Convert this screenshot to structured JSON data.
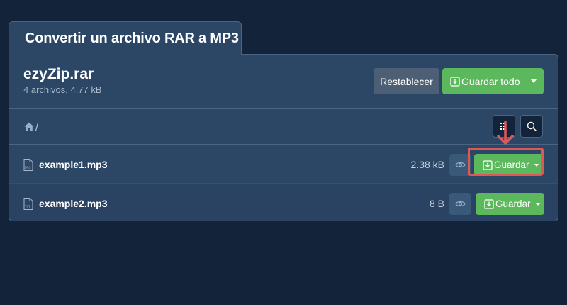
{
  "tab": {
    "title": "Convertir un archivo RAR a MP3"
  },
  "archive": {
    "name": "ezyZip.rar",
    "info": "4 archivos, 4.77 kB"
  },
  "toolbar": {
    "reset_label": "Restablecer",
    "save_all_label": "Guardar todo"
  },
  "path": {
    "current": "/"
  },
  "files": [
    {
      "name": "example1.mp3",
      "size": "2.38 kB",
      "icon_tag": "PNG",
      "save_label": "Guardar"
    },
    {
      "name": "example2.mp3",
      "size": "8 B",
      "icon_tag": "TXT",
      "save_label": "Guardar"
    }
  ],
  "icons": {
    "home": "home-icon",
    "list": "list-icon",
    "search": "search-icon",
    "file": "file-icon",
    "eye": "eye-icon",
    "download": "download-icon",
    "caret": "caret-down-icon",
    "arrow": "arrow-down-annotation"
  },
  "colors": {
    "background": "#12233a",
    "panel": "#2c4766",
    "accent_green": "#5cb85c",
    "reset_gray": "#4c5f74",
    "highlight_red": "#e05757"
  }
}
